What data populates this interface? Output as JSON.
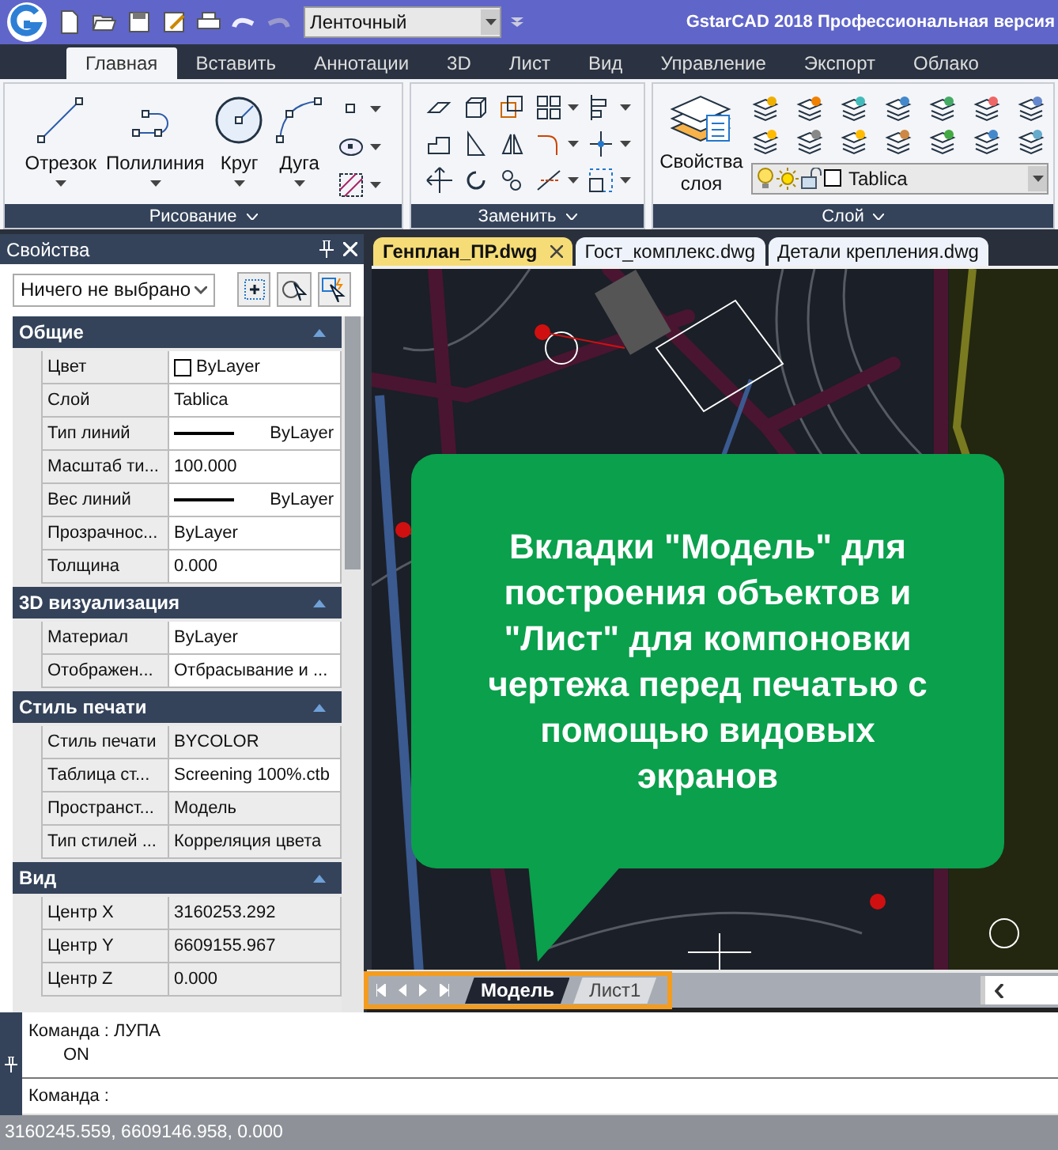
{
  "title_bar": {
    "workspace": "Ленточный",
    "title": "GstarCAD 2018 Профессиональная версия"
  },
  "ribbon_tabs": [
    {
      "label": "Главная",
      "selected": true
    },
    {
      "label": "Вставить",
      "selected": false
    },
    {
      "label": "Аннотации",
      "selected": false
    },
    {
      "label": "3D",
      "selected": false
    },
    {
      "label": "Лист",
      "selected": false
    },
    {
      "label": "Вид",
      "selected": false
    },
    {
      "label": "Управление",
      "selected": false
    },
    {
      "label": "Экспорт",
      "selected": false
    },
    {
      "label": "Облако",
      "selected": false
    }
  ],
  "ribbon_panels": [
    {
      "kind": "draw",
      "title": "Рисование",
      "tools": [
        "Отрезок",
        "Полилиния",
        "Круг",
        "Дуга"
      ]
    },
    {
      "kind": "modify",
      "title": "Заменить"
    },
    {
      "kind": "layer",
      "title": "Слой",
      "tools": [
        "Свойства слоя"
      ],
      "current_layer": "Tablica"
    }
  ],
  "properties": {
    "title": "Свойства",
    "selection": "Ничего не выбрано",
    "groups": [
      {
        "title": "Общие",
        "expanded": true,
        "rows": [
          {
            "kind": "color",
            "name": "Цвет",
            "value": "ByLayer",
            "readonly": false
          },
          {
            "kind": "text",
            "name": "Слой",
            "value": "Tablica",
            "readonly": false
          },
          {
            "kind": "linetype",
            "name": "Тип линий",
            "value": "ByLayer",
            "readonly": false
          },
          {
            "kind": "text",
            "name": "Масштаб ти...",
            "value": "100.000",
            "readonly": false
          },
          {
            "kind": "linetype",
            "name": "Вес линий",
            "value": "ByLayer",
            "readonly": false
          },
          {
            "kind": "text",
            "name": "Прозрачнос...",
            "value": "ByLayer",
            "readonly": false
          },
          {
            "kind": "text",
            "name": "Толщина",
            "value": "0.000",
            "readonly": false
          }
        ]
      },
      {
        "title": "3D визуализация",
        "expanded": true,
        "rows": [
          {
            "kind": "text",
            "name": "Материал",
            "value": "ByLayer",
            "readonly": false
          },
          {
            "kind": "text",
            "name": "Отображен...",
            "value": "Отбрасывание и ...",
            "readonly": false
          }
        ]
      },
      {
        "title": "Стиль печати",
        "expanded": true,
        "rows": [
          {
            "kind": "text",
            "name": "Стиль печати",
            "value": "BYCOLOR",
            "readonly": true
          },
          {
            "kind": "text",
            "name": "Таблица ст...",
            "value": "Screening 100%.ctb",
            "readonly": false
          },
          {
            "kind": "text",
            "name": "Пространст...",
            "value": "Модель",
            "readonly": true
          },
          {
            "kind": "text",
            "name": "Тип стилей ...",
            "value": "Корреляция цвета",
            "readonly": true
          }
        ]
      },
      {
        "title": "Вид",
        "expanded": true,
        "rows": [
          {
            "kind": "text",
            "name": "Центр X",
            "value": "3160253.292",
            "readonly": true
          },
          {
            "kind": "text",
            "name": "Центр Y",
            "value": "6609155.967",
            "readonly": true
          },
          {
            "kind": "text",
            "name": "Центр Z",
            "value": "0.000",
            "readonly": true
          }
        ]
      }
    ]
  },
  "document_tabs": [
    {
      "label": "Генплан_ПР.dwg",
      "selected": true
    },
    {
      "label": "Гост_комплекс.dwg",
      "selected": false
    },
    {
      "label": "Детали крепления.dwg",
      "selected": false
    }
  ],
  "callout": {
    "text": "Вкладки \"Модель\" для построения объектов и \"Лист\" для компоновки чертежа перед печатью с помощью видовых экранов"
  },
  "layout_tabs": [
    {
      "label": "Модель",
      "selected": true
    },
    {
      "label": "Лист1",
      "selected": false
    }
  ],
  "command_line": {
    "history": [
      "Команда : ЛУПА",
      "ON"
    ],
    "prompt": "Команда :"
  },
  "status_bar": {
    "coordinates": "3160245.559, 6609146.958, 0.000"
  }
}
